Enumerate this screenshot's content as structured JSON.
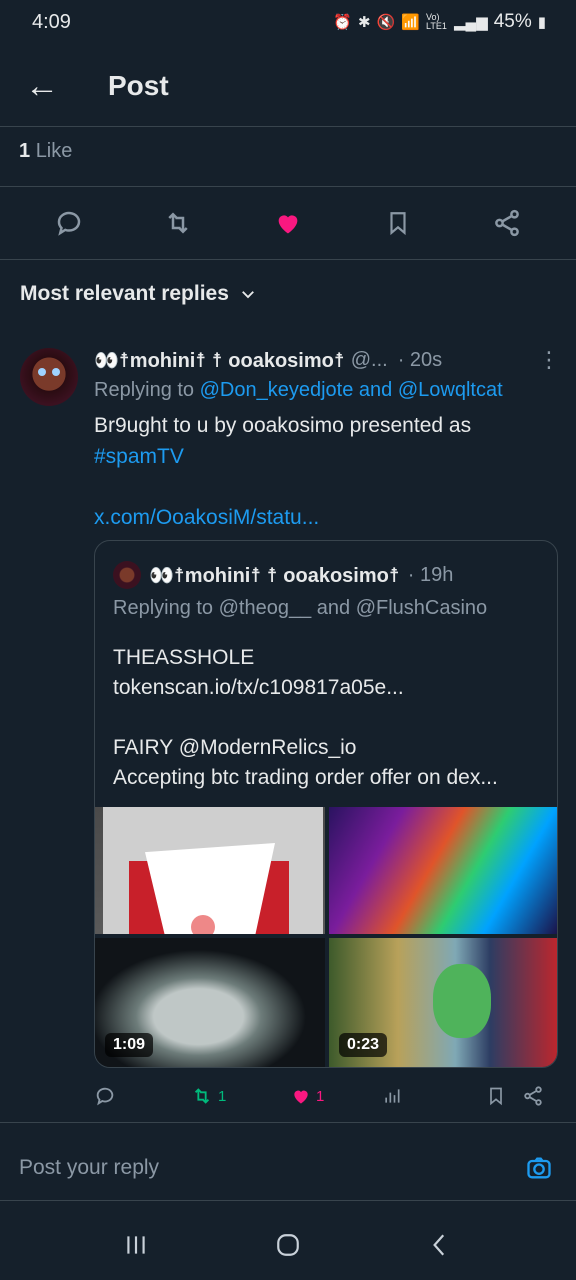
{
  "status": {
    "time": "4:09",
    "network": "Vo) LTE1",
    "battery": "45%"
  },
  "header": {
    "title": "Post"
  },
  "likes": {
    "count": "1",
    "label": "Like"
  },
  "sort": {
    "label": "Most relevant replies"
  },
  "reply": {
    "name": "👀☨mohini☨ ☨ ooakosimo☨",
    "handle": "@...",
    "time": "· 20s",
    "replying_prefix": "Replying to",
    "replying_users": "@Don_keyedjote and @Lowqltcat",
    "text_line1": "Br9ught to u by ooakosimo presented as",
    "hashtag": "#spamTV",
    "link": "x.com/OoakosiM/statu..."
  },
  "quote": {
    "name": "👀☨mohini☨ ☨ ooakosimo☨",
    "time": "· 19h",
    "replying": "Replying to @theog__ and @FlushCasino",
    "text": "THEASSHOLE\ntokenscan.io/tx/c109817a05e...\n\nFAIRY @ModernRelics_io\nAccepting btc trading order offer on dex...",
    "media": {
      "video1_duration": "1:09",
      "video2_duration": "0:23"
    }
  },
  "reply_actions": {
    "retweets": "1",
    "likes": "1"
  },
  "compose": {
    "placeholder": "Post your reply"
  },
  "colors": {
    "accent": "#1d9bf0",
    "like": "#f91880",
    "retweet": "#00ba7c",
    "background": "#15202b"
  }
}
